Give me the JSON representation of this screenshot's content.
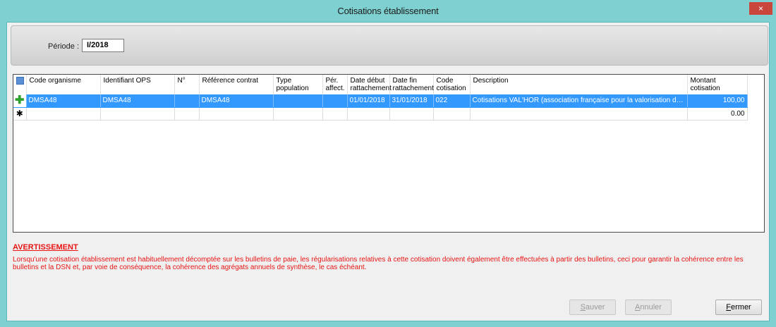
{
  "window": {
    "title": "Cotisations établissement",
    "close_label": "×"
  },
  "period": {
    "label": "Période :",
    "value": "I/2018"
  },
  "grid": {
    "columns": [
      "Code organisme",
      "Identifiant OPS",
      "N°",
      "Référence contrat",
      "Type population",
      "Pér. affect.",
      "Date début rattachement",
      "Date fin rattachement",
      "Code cotisation",
      "Description",
      "Montant cotisation"
    ],
    "rows": [
      {
        "code_organisme": "DMSA48",
        "identifiant_ops": "DMSA48",
        "numero": "",
        "reference_contrat": "DMSA48",
        "type_population": "",
        "per_affect": "",
        "date_debut": "01/01/2018",
        "date_fin": "31/01/2018",
        "code_cotisation": "022",
        "description": "Cotisations VAL'HOR (association française pour la valorisation des pr...",
        "montant": "100,00"
      }
    ],
    "new_row": {
      "montant": "0.00"
    }
  },
  "warning": {
    "title": "AVERTISSEMENT",
    "text": "Lorsqu'une cotisation établissement est habituellement décomptée sur les bulletins de paie, les régularisations relatives à cette cotisation doivent également être effectuées à partir des bulletins, ceci pour garantir la cohérence entre les bulletins et la DSN et, par voie de conséquence, la cohérence des agrégats annuels de synthèse, le cas échéant."
  },
  "buttons": {
    "save_first": "S",
    "save_rest": "auver",
    "cancel_first": "A",
    "cancel_rest": "nnuler",
    "close_first": "F",
    "close_rest": "ermer"
  },
  "icons": {
    "row_indicator_current": "plus-icon",
    "row_indicator_new": "star-icon"
  },
  "colors": {
    "titlebar": "#7fd0d0",
    "selection": "#3399ff",
    "warning": "#e81414",
    "close_button": "#c9463d"
  }
}
